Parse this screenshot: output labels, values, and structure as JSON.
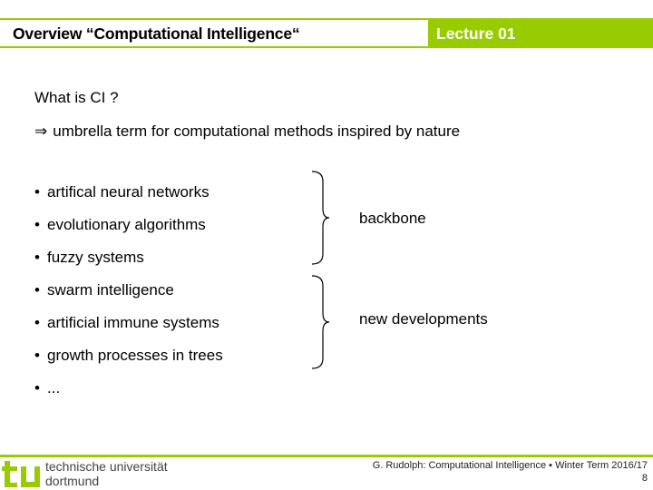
{
  "header": {
    "title": "Overview “Computational Intelligence“",
    "lecture": "Lecture 01",
    "accent_color": "#99cc00"
  },
  "question": "What is CI ?",
  "answer": {
    "arrow_symbol": "⇒",
    "text": "umbrella term for computational methods inspired by nature"
  },
  "bullet_symbol": "•",
  "bullets": [
    "artifical neural networks",
    "evolutionary algorithms",
    "fuzzy systems",
    "swarm intelligence",
    "artificial immune systems",
    "growth processes in trees",
    "..."
  ],
  "groups": [
    {
      "label": "backbone",
      "covers": [
        "artifical neural networks",
        "evolutionary algorithms",
        "fuzzy systems"
      ]
    },
    {
      "label": "new developments",
      "covers": [
        "swarm intelligence",
        "artificial immune systems",
        "growth processes in trees"
      ]
    }
  ],
  "footer": {
    "university_line1": "technische universität",
    "university_line2": "dortmund",
    "logo_text": "tu",
    "credit": "G. Rudolph: Computational Intelligence ▪ Winter Term 2016/17",
    "page_number": "8"
  }
}
